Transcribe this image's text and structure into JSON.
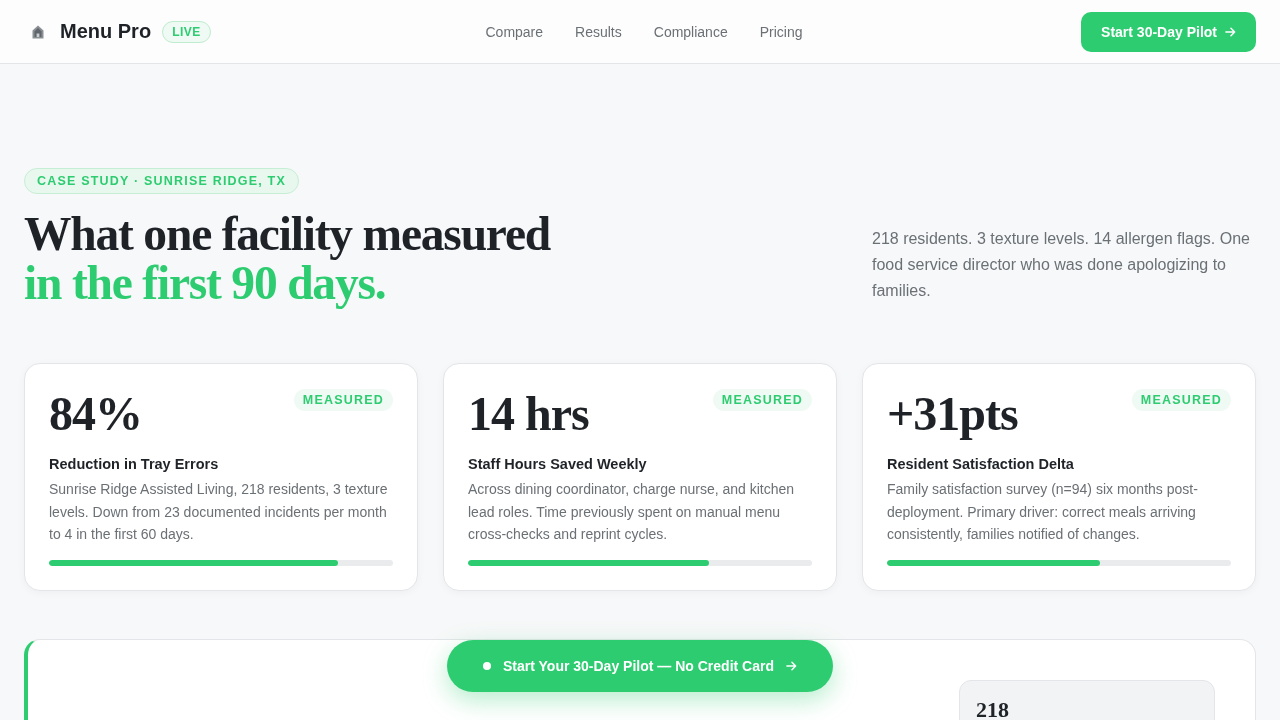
{
  "header": {
    "logo_text": "Menu Pro",
    "badge": "LIVE",
    "nav": [
      "Compare",
      "Results",
      "Compliance",
      "Pricing"
    ],
    "cta": "Start 30-Day Pilot"
  },
  "hero": {
    "eyebrow": "CASE STUDY · SUNRISE RIDGE, TX",
    "headline": "What one facility measured",
    "headline_accent": "in the first 90 days.",
    "intro": "218 residents. 3 texture levels. 14 allergen flags. One food service director who was done apologizing to families."
  },
  "metrics": [
    {
      "value": "84%",
      "badge": "MEASURED",
      "title": "Reduction in Tray Errors",
      "description": "Sunrise Ridge Assisted Living, 218 residents, 3 texture levels. Down from 23 documented incidents per month to 4 in the first 60 days.",
      "level": 0.84
    },
    {
      "value": "14 hrs",
      "badge": "MEASURED",
      "title": "Staff Hours Saved Weekly",
      "description": "Across dining coordinator, charge nurse, and kitchen lead roles. Time previously spent on manual menu cross-checks and reprint cycles.",
      "level": 0.7
    },
    {
      "value": "+31pts",
      "badge": "MEASURED",
      "title": "Resident Satisfaction Delta",
      "description": "Family satisfaction survey (n=94) six months post-deployment. Primary driver: correct meals arriving consistently, families notified of changes.",
      "level": 0.62
    }
  ],
  "detail_panel": {
    "stat": "218"
  },
  "floating_cta": {
    "label": "Start Your 30-Day Pilot — No Credit Card"
  }
}
